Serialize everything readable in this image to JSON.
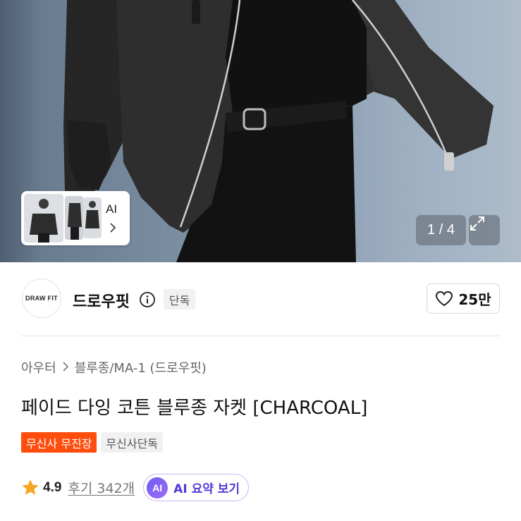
{
  "gallery": {
    "page_indicator": "1 / 4",
    "ai_thumb_label": "AI"
  },
  "brand": {
    "logo_text": "DRAW FIT",
    "name": "드로우핏",
    "badge": "단독",
    "like_count": "25만"
  },
  "breadcrumb": {
    "items": [
      "아우터",
      "블루종/MA-1 (드로우핏)"
    ]
  },
  "product": {
    "title": "페이드 다잉 코튼 블루종 자켓 [CHARCOAL]",
    "tags": [
      "무신사 무진장",
      "무신사단독"
    ]
  },
  "reviews": {
    "rating": "4.9",
    "review_link": "후기 342개",
    "ai_badge": "AI",
    "ai_summary_label": "AI 요약 보기"
  },
  "colors": {
    "accent_orange": "#ff4d0d",
    "ai_purple": "#4f3bd6",
    "star": "#f5a623"
  }
}
